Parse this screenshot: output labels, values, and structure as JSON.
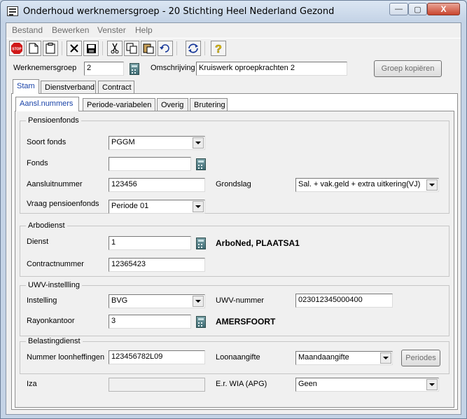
{
  "window": {
    "title": "Onderhoud werknemersgroep - 20 Stichting Heel Nederland Gezond",
    "controls": {
      "minimize": "—",
      "maximize": "▢",
      "close": "X"
    }
  },
  "menu": [
    "Bestand",
    "Bewerken",
    "Venster",
    "Help"
  ],
  "toolbar": {
    "buttons": [
      {
        "name": "stop",
        "icon": "stop-icon",
        "glyph": "STOP",
        "color": "#d01818"
      },
      {
        "name": "new",
        "icon": "new-document-icon",
        "glyph": "🗋"
      },
      {
        "name": "clipboard",
        "icon": "clipboard-icon",
        "glyph": "📋"
      },
      {
        "name": "delete",
        "icon": "delete-x-icon",
        "glyph": "✕"
      },
      {
        "name": "save",
        "icon": "save-disk-icon",
        "glyph": "💾"
      },
      {
        "name": "cut",
        "icon": "scissors-icon",
        "glyph": "✂"
      },
      {
        "name": "copy",
        "icon": "copy-icon",
        "glyph": "⧉"
      },
      {
        "name": "paste",
        "icon": "paste-icon",
        "glyph": "📋"
      },
      {
        "name": "undo",
        "icon": "undo-icon",
        "glyph": "↶"
      },
      {
        "name": "refresh",
        "icon": "refresh-icon",
        "glyph": "⟲"
      },
      {
        "name": "help",
        "icon": "help-question-icon",
        "glyph": "?",
        "color": "#e6c400"
      }
    ]
  },
  "header": {
    "werknemersgroep_label": "Werknemersgroep",
    "werknemersgroep_value": "2",
    "omschrijving_label": "Omschrijving",
    "omschrijving_value": "Kruiswerk oproepkrachten 2",
    "copy_button": "Groep kopiëren"
  },
  "tabs": [
    "Stam",
    "Dienstverband",
    "Contract"
  ],
  "subtabs": [
    "Aansl.nummers",
    "Periode-variabelen",
    "Overig",
    "Brutering"
  ],
  "pensioenfonds": {
    "title": "Pensioenfonds",
    "soort_fonds_label": "Soort fonds",
    "soort_fonds_value": "PGGM",
    "fonds_label": "Fonds",
    "fonds_value": "",
    "aansluitnummer_label": "Aansluitnummer",
    "aansluitnummer_value": "123456",
    "grondslag_label": "Grondslag",
    "grondslag_value": "Sal. + vak.geld + extra uitkering(VJ)",
    "vraag_label": "Vraag pensioenfonds",
    "vraag_value": "Periode 01"
  },
  "arbodienst": {
    "title": "Arbodienst",
    "dienst_label": "Dienst",
    "dienst_value": "1",
    "dienst_name": "ArboNed, PLAATSA1",
    "contract_label": "Contractnummer",
    "contract_value": "12365423"
  },
  "uwv": {
    "title": "UWV-instellling",
    "instelling_label": "Instelling",
    "instelling_value": "BVG",
    "uwv_nummer_label": "UWV-nummer",
    "uwv_nummer_value": "023012345000400",
    "rayon_label": "Rayonkantoor",
    "rayon_value": "3",
    "rayon_name": "AMERSFOORT"
  },
  "belasting": {
    "title": "Belastingdienst",
    "loonheffing_label": "Nummer loonheffingen",
    "loonheffing_value": "123456782L09",
    "aangifte_label": "Loonaangifte",
    "aangifte_value": "Maandaangifte",
    "periodes_button": "Periodes"
  },
  "footer": {
    "iza_label": "Iza",
    "iza_value": "",
    "wia_label": "E.r. WIA (APG)",
    "wia_value": "Geen"
  }
}
